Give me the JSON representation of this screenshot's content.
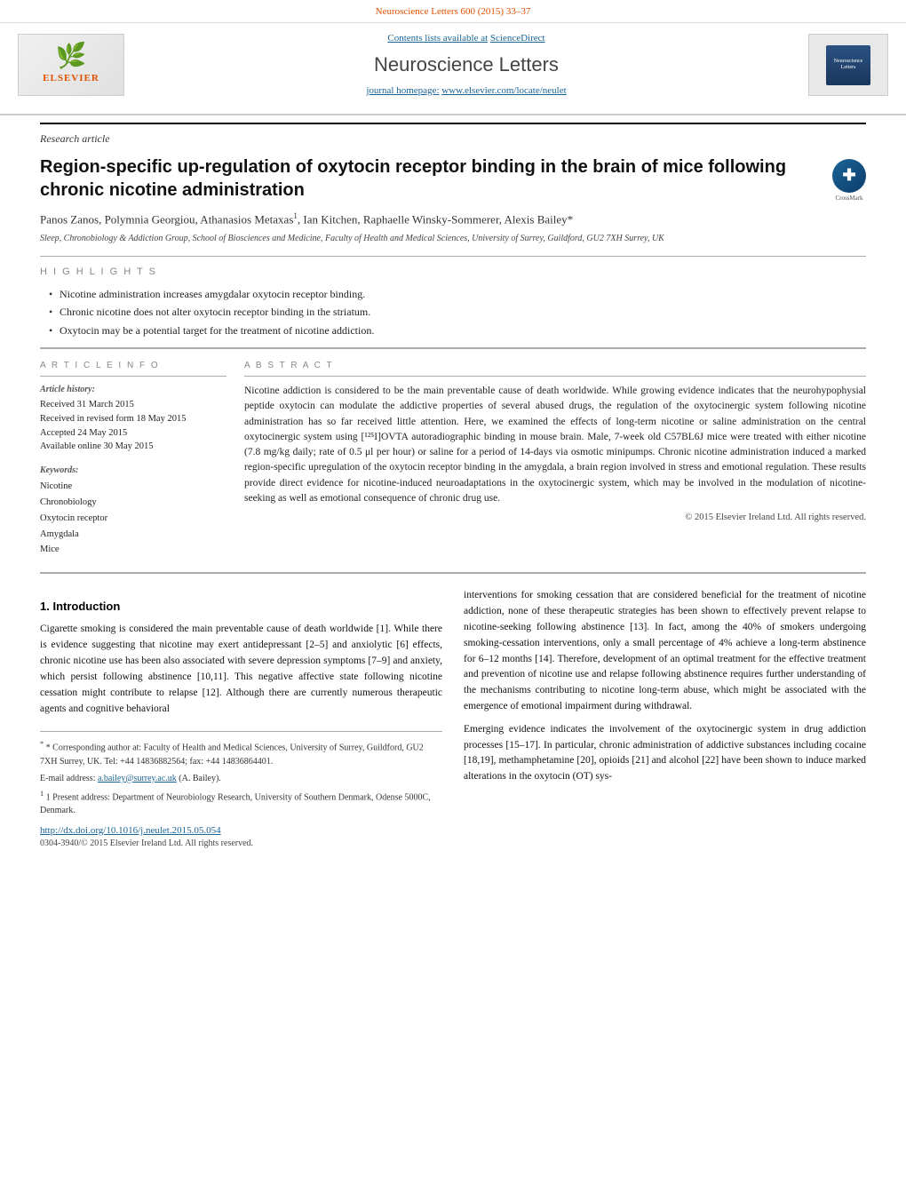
{
  "journal": {
    "top_citation": "Neuroscience Letters 600 (2015) 33–37",
    "contents_label": "Contents lists available at",
    "contents_link": "ScienceDirect",
    "title": "Neuroscience Letters",
    "homepage_label": "journal homepage:",
    "homepage_link": "www.elsevier.com/locate/neulet",
    "elsevier_logo_text": "ELSEVIER",
    "logo_tree": "🌿"
  },
  "article": {
    "type": "Research article",
    "title": "Region-specific up-regulation of oxytocin receptor binding in the brain of mice following chronic nicotine administration",
    "authors": "Panos Zanos, Polymnia Georgiou, Athanasios Metaxas",
    "authors_sup": "1",
    "authors_cont": ", Ian Kitchen, Raphaelle Winsky-Sommerer, Alexis Bailey",
    "authors_asterisk": "*",
    "affiliation": "Sleep, Chronobiology & Addiction Group, School of Biosciences and Medicine, Faculty of Health and Medical Sciences, University of Surrey, Guildford, GU2 7XH Surrey, UK"
  },
  "highlights": {
    "header": "H I G H L I G H T S",
    "items": [
      "Nicotine administration increases amygdalar oxytocin receptor binding.",
      "Chronic nicotine does not alter oxytocin receptor binding in the striatum.",
      "Oxytocin may be a potential target for the treatment of nicotine addiction."
    ]
  },
  "article_info": {
    "header": "A R T I C L E   I N F O",
    "history_label": "Article history:",
    "received": "Received 31 March 2015",
    "revised": "Received in revised form 18 May 2015",
    "accepted": "Accepted 24 May 2015",
    "online": "Available online 30 May 2015",
    "keywords_label": "Keywords:",
    "keywords": [
      "Nicotine",
      "Chronobiology",
      "Oxytocin receptor",
      "Amygdala",
      "Mice"
    ]
  },
  "abstract": {
    "header": "A B S T R A C T",
    "text": "Nicotine addiction is considered to be the main preventable cause of death worldwide. While growing evidence indicates that the neurohypophysial peptide oxytocin can modulate the addictive properties of several abused drugs, the regulation of the oxytocinergic system following nicotine administration has so far received little attention. Here, we examined the effects of long-term nicotine or saline administration on the central oxytocinergic system using [¹²⁵I]OVTA autoradiographic binding in mouse brain. Male, 7-week old C57BL6J mice were treated with either nicotine (7.8 mg/kg daily; rate of 0.5 μl per hour) or saline for a period of 14-days via osmotic minipumps. Chronic nicotine administration induced a marked region-specific upregulation of the oxytocin receptor binding in the amygdala, a brain region involved in stress and emotional regulation. These results provide direct evidence for nicotine-induced neuroadaptations in the oxytocinergic system, which may be involved in the modulation of nicotine-seeking as well as emotional consequence of chronic drug use.",
    "copyright": "© 2015 Elsevier Ireland Ltd. All rights reserved."
  },
  "intro": {
    "section": "1.  Introduction",
    "col1": {
      "p1": "Cigarette smoking is considered the main preventable cause of death worldwide [1]. While there is evidence suggesting that nicotine may exert antidepressant [2–5] and anxiolytic [6] effects, chronic nicotine use has been also associated with severe depression symptoms [7–9] and anxiety, which persist following abstinence [10,11]. This negative affective state following nicotine cessation might contribute to relapse [12]. Although there are currently numerous therapeutic agents and cognitive behavioral",
      "footnotes": {
        "star": "* Corresponding author at: Faculty of Health and Medical Sciences, University of Surrey, Guildford, GU2 7XH Surrey, UK. Tel: +44 14836882564; fax: +44 14836864401.",
        "email_label": "E-mail address:",
        "email": "a.bailey@surrey.ac.uk",
        "email_person": "(A. Bailey).",
        "sup1": "1 Present address: Department of Neurobiology Research, University of Southern Denmark, Odense 5000C, Denmark."
      }
    },
    "col2": {
      "p1": "interventions for smoking cessation that are considered beneficial for the treatment of nicotine addiction, none of these therapeutic strategies has been shown to effectively prevent relapse to nicotine-seeking following abstinence [13]. In fact, among the 40% of smokers undergoing smoking-cessation interventions, only a small percentage of 4% achieve a long-term abstinence for 6–12 months [14]. Therefore, development of an optimal treatment for the effective treatment and prevention of nicotine use and relapse following abstinence requires further understanding of the mechanisms contributing to nicotine long-term abuse, which might be associated with the emergence of emotional impairment during withdrawal.",
      "p2": "Emerging evidence indicates the involvement of the oxytocinergic system in drug addiction processes [15–17]. In particular, chronic administration of addictive substances including cocaine [18,19], methamphetamine [20], opioids [21] and alcohol [22] have been shown to induce marked alterations in the oxytocin (OT) sys-"
    }
  },
  "footer": {
    "doi": "http://dx.doi.org/10.1016/j.neulet.2015.05.054",
    "issn": "0304-3940/© 2015 Elsevier Ireland Ltd. All rights reserved."
  }
}
